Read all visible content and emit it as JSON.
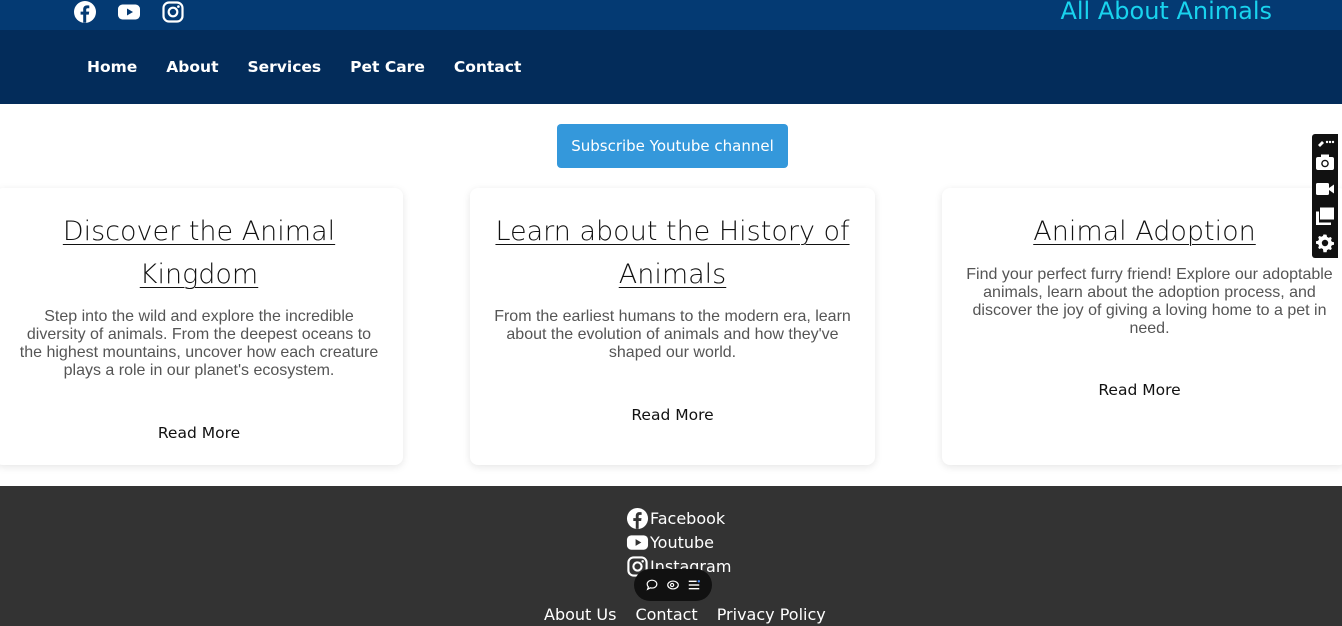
{
  "header": {
    "brand": "All About Animals",
    "social_icons": [
      "facebook-icon",
      "youtube-icon",
      "instagram-icon"
    ],
    "nav": [
      "Home",
      "About",
      "Services",
      "Pet Care",
      "Contact"
    ]
  },
  "subscribe_label": "Subscribe Youtube channel",
  "cards": [
    {
      "title": "Discover the Animal Kingdom",
      "text": "Step into the wild and explore the incredible diversity of animals. From the deepest oceans to the highest mountains, uncover how each creature plays a role in our planet's ecosystem.",
      "link": "Read More"
    },
    {
      "title": "Learn about the History of Animals",
      "text": "From the earliest humans to the modern era, learn about the evolution of animals and how they've shaped our world.",
      "link": "Read More"
    },
    {
      "title": "Animal Adoption",
      "text": "Find your perfect furry friend! Explore our adoptable animals, learn about the adoption process, and discover the joy of giving a loving home to a pet in need.",
      "link": "Read More"
    }
  ],
  "footer": {
    "social": [
      "Facebook",
      "Youtube",
      "Instagram"
    ],
    "links": [
      "About Us",
      "Contact",
      "Privacy Policy"
    ]
  },
  "colors": {
    "topbar": "#043a73",
    "navbar": "#032c5a",
    "brand": "#19d3ee",
    "button": "#3498db",
    "footer": "#333333"
  },
  "overlay": {
    "pill_icons": [
      "comment-icon",
      "eye-icon",
      "list-icon"
    ],
    "toolbar_icons": [
      "pin-icon",
      "camera-icon",
      "video-icon",
      "window-icon",
      "gear-icon"
    ]
  }
}
